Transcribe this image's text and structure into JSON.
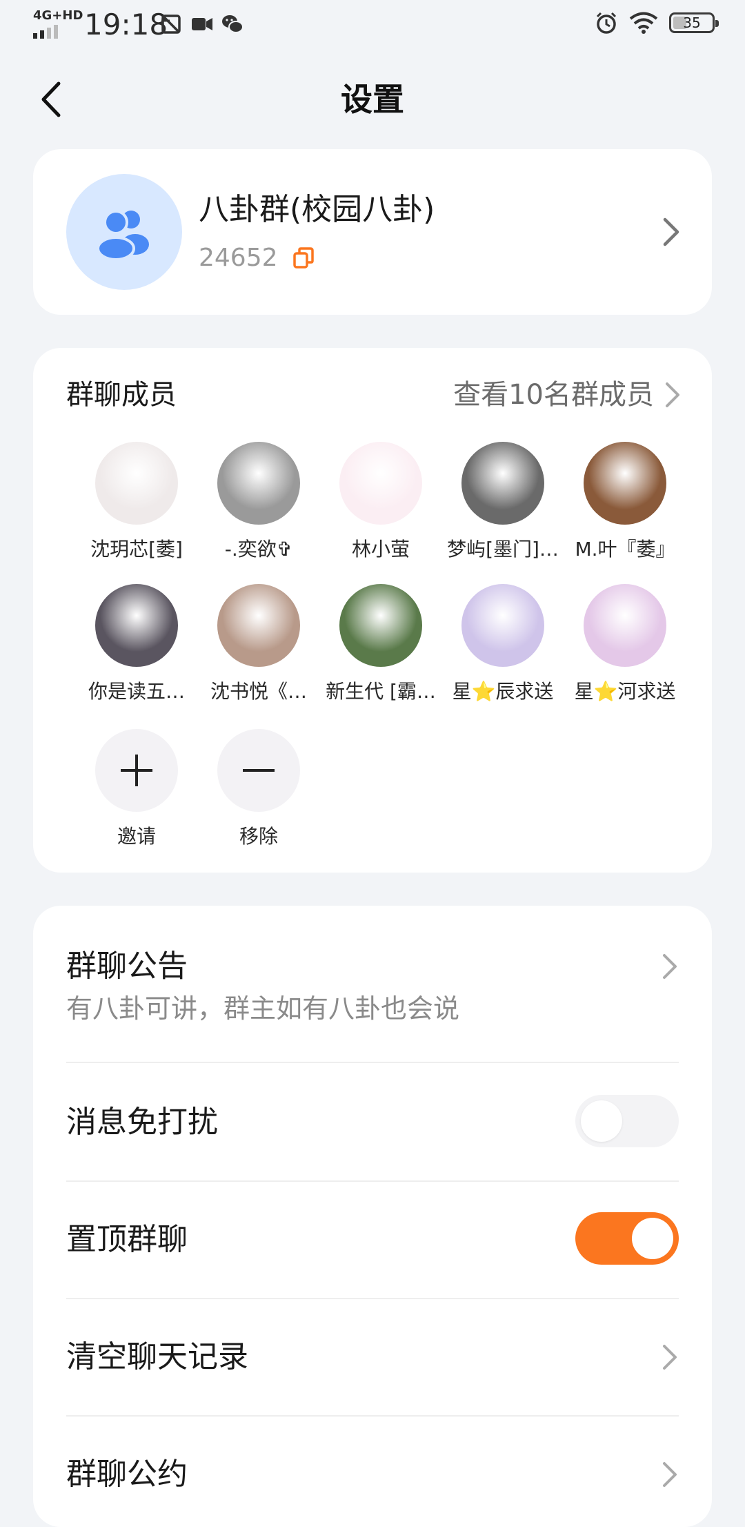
{
  "status_bar": {
    "network": "4G+HD",
    "time": "19:18",
    "battery": "35",
    "battery_level": 0.35
  },
  "header": {
    "title": "设置"
  },
  "group": {
    "name": "八卦群(校园八卦)",
    "id": "24652"
  },
  "members": {
    "title": "群聊成员",
    "view_all": "查看10名群成员",
    "list": [
      {
        "name": "沈玥芯[萎]",
        "avatar_color": "#efeaea"
      },
      {
        "name": "-.奕欲✞",
        "avatar_color": "#9a9a9a"
      },
      {
        "name": "林小萤",
        "avatar_color": "#fbeef3"
      },
      {
        "name": "梦屿[墨门]…",
        "avatar_color": "#6a6a6a"
      },
      {
        "name": "M.叶『萎』",
        "avatar_color": "#8a5a3a"
      },
      {
        "name": "你是读五…",
        "avatar_color": "#5a5560"
      },
      {
        "name": "沈书悦《…",
        "avatar_color": "#b89a8a"
      },
      {
        "name": "新生代 [霸…",
        "avatar_color": "#5a7a4a"
      },
      {
        "name": "星⭐辰求送",
        "avatar_color": "#cfc4ea"
      },
      {
        "name": "星⭐河求送",
        "avatar_color": "#e4c8e8"
      }
    ],
    "invite_label": "邀请",
    "remove_label": "移除"
  },
  "settings": {
    "announcement_label": "群聊公告",
    "announcement_text": "有八卦可讲，群主如有八卦也会说",
    "dnd_label": "消息免打扰",
    "dnd_on": false,
    "pin_label": "置顶群聊",
    "pin_on": true,
    "clear_label": "清空聊天记录",
    "rules_label": "群聊公约"
  },
  "colors": {
    "accent": "#fb761f",
    "avatar_blue": "#4a8af5",
    "avatar_bg": "#d8e8ff",
    "page_bg": "#f2f4f7"
  }
}
